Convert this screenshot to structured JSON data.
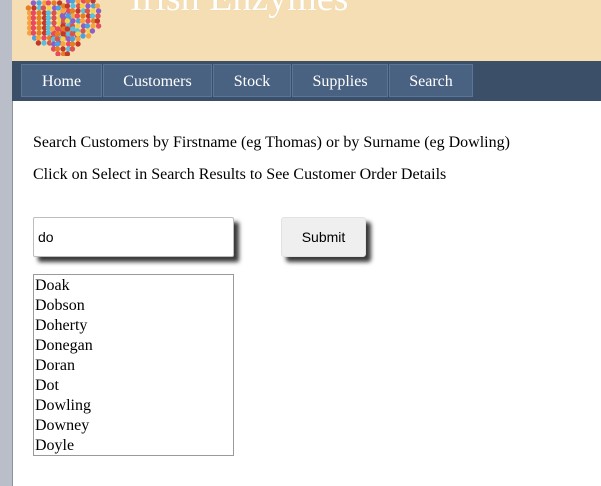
{
  "header": {
    "site_title": "Irish Enzymes",
    "logo_icon": "molecule-cluster-icon",
    "background_color": "#f5deb3"
  },
  "nav": {
    "background_color": "#3b5068",
    "items": [
      {
        "label": "Home"
      },
      {
        "label": "Customers"
      },
      {
        "label": "Stock"
      },
      {
        "label": "Supplies"
      },
      {
        "label": "Search"
      }
    ]
  },
  "main": {
    "instruction_1": "Search Customers by Firstname (eg Thomas) or by Surname (eg Dowling)",
    "instruction_2": "Click on Select in Search Results to See Customer Order Details",
    "search": {
      "value": "do",
      "placeholder": ""
    },
    "submit_label": "Submit",
    "results": [
      "Doak",
      "Dobson",
      "Doherty",
      "Donegan",
      "Doran",
      "Dot",
      "Dowling",
      "Downey",
      "Doyle"
    ]
  }
}
